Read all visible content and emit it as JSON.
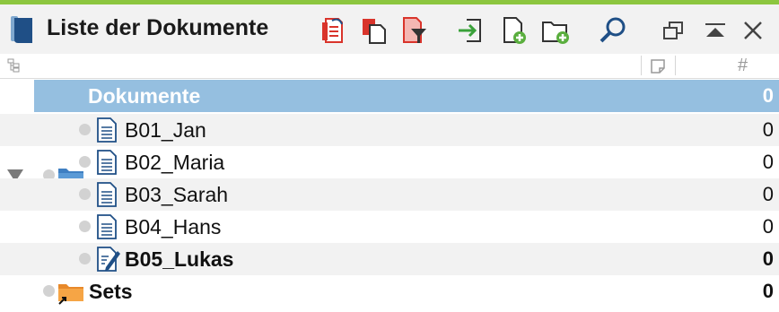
{
  "window": {
    "title": "Liste der Dokumente",
    "accent_color": "#8cc63f"
  },
  "toolbar": {
    "icons": [
      "retrieve-coded-segments-icon",
      "copy-documents-icon",
      "filter-documents-icon",
      "import-icon",
      "new-document-icon",
      "new-document-group-icon",
      "search-icon",
      "undock-icon",
      "collapse-icon",
      "close-icon"
    ]
  },
  "columns": {
    "tree": "tree-structure-icon",
    "memo": "memo-icon",
    "count": "#"
  },
  "tree": {
    "root": {
      "label": "Dokumente",
      "count": "0",
      "selected": true,
      "selection_color": "#95bfe0"
    },
    "documents": [
      {
        "label": "B01_Jan",
        "count": "0",
        "bold": false
      },
      {
        "label": "B02_Maria",
        "count": "0",
        "bold": false
      },
      {
        "label": "B03_Sarah",
        "count": "0",
        "bold": false
      },
      {
        "label": "B04_Hans",
        "count": "0",
        "bold": false
      },
      {
        "label": "B05_Lukas",
        "count": "0",
        "bold": true
      }
    ],
    "sets": {
      "label": "Sets",
      "count": "0"
    }
  }
}
